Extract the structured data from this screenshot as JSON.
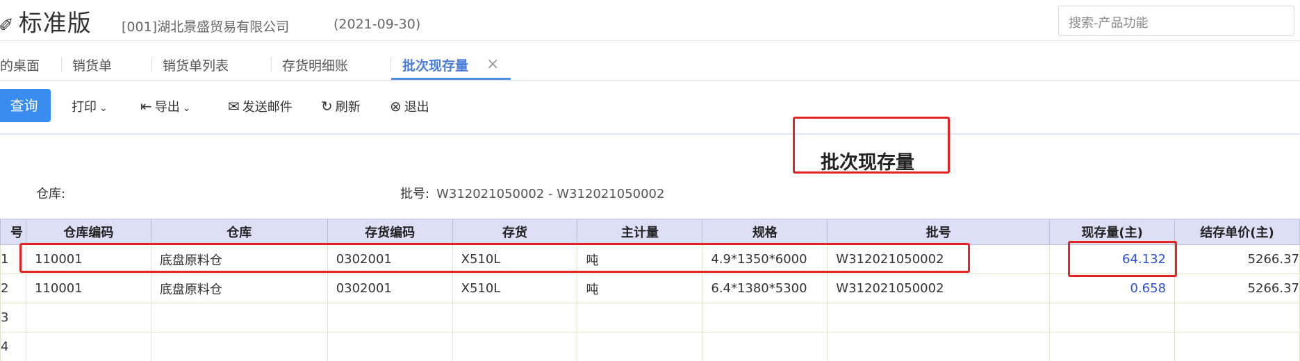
{
  "header": {
    "brand": "标准版",
    "company": "[001]湖北景盛贸易有限公司",
    "date": "(2021-09-30)",
    "search_placeholder": "搜索-产品功能"
  },
  "tabs": [
    {
      "label": "的桌面"
    },
    {
      "label": "销货单"
    },
    {
      "label": "销货单列表"
    },
    {
      "label": "存货明细账"
    },
    {
      "label": "批次现存量",
      "active": true
    }
  ],
  "toolbar": {
    "query": "查询",
    "print": "打印",
    "export": "导出",
    "send_mail": "发送邮件",
    "refresh": "刷新",
    "exit": "退出"
  },
  "report": {
    "title": "批次现存量",
    "warehouse_label": "仓库:",
    "warehouse_value": "",
    "batch_label": "批号:",
    "batch_value": "W312021050002 - W312021050002"
  },
  "table": {
    "columns": [
      "号",
      "仓库编码",
      "仓库",
      "存货编码",
      "存货",
      "主计量",
      "规格",
      "批号",
      "现存量(主)",
      "结存单价(主)"
    ],
    "rows": [
      {
        "no": "1",
        "wh_code": "110001",
        "wh": "底盘原料仓",
        "item_code": "0302001",
        "item": "X510L",
        "unit": "吨",
        "spec": "4.9*1350*6000",
        "batch": "W312021050002",
        "qty": "64.132",
        "price": "5266.37"
      },
      {
        "no": "2",
        "wh_code": "110001",
        "wh": "底盘原料仓",
        "item_code": "0302001",
        "item": "X510L",
        "unit": "吨",
        "spec": "6.4*1380*5300",
        "batch": "W312021050002",
        "qty": "0.658",
        "price": "5266.37"
      },
      {
        "no": "3"
      },
      {
        "no": "4"
      }
    ]
  },
  "colors": {
    "accent": "#3a8df0",
    "highlight": "#e52222",
    "header_bg": "#dcdff5"
  }
}
